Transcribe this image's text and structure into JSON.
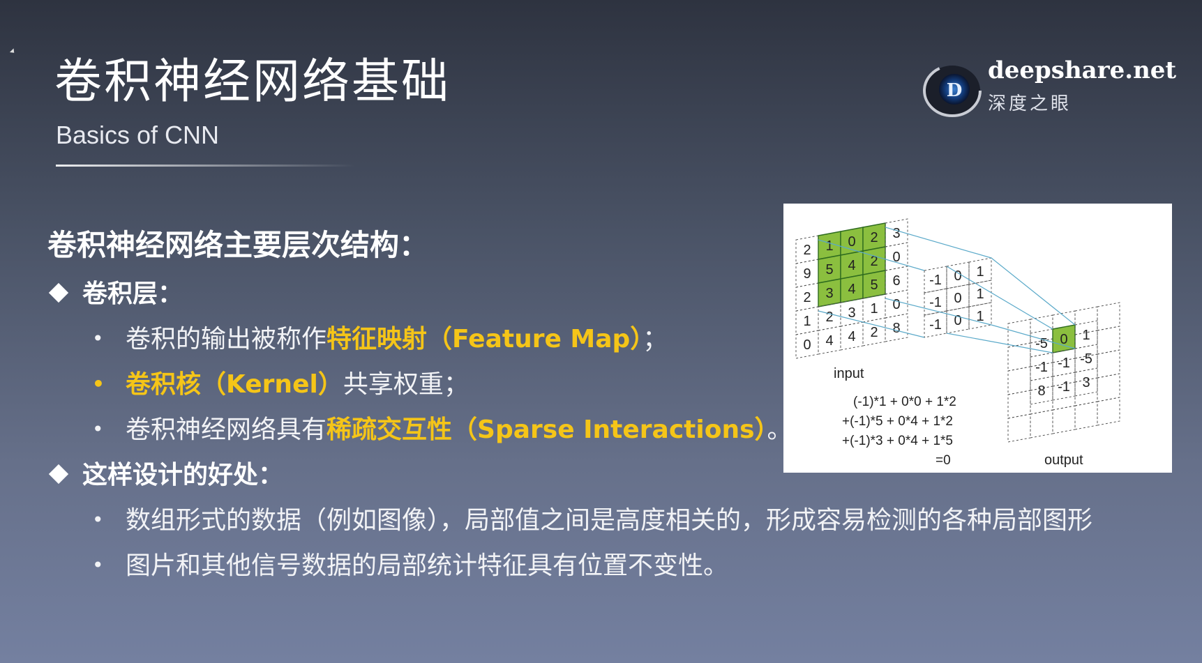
{
  "header": {
    "title": "卷积神经网络基础",
    "subtitle": "Basics of CNN"
  },
  "brand": {
    "name": "deepshare.net",
    "sub": "深度之眼",
    "logo_letter": "D"
  },
  "content": {
    "heading": "卷积神经网络主要层次结构：",
    "sections": [
      {
        "label": "卷积层：",
        "bullets": [
          {
            "pre": "卷积的输出被称作",
            "hl": "特征映射（Feature Map）",
            "post": "；"
          },
          {
            "pre": "",
            "hl": "卷积核（Kernel）",
            "post": "共享权重；"
          },
          {
            "pre": "卷积神经网络具有",
            "hl": "稀疏交互性（Sparse Interactions）",
            "post": "。"
          }
        ]
      },
      {
        "label": "这样设计的好处：",
        "bullets": [
          {
            "pre": "数组形式的数据（例如图像），局部值之间是高度相关的，形成容易检测的各种局部图形",
            "hl": "",
            "post": ""
          },
          {
            "pre": "图片和其他信号数据的局部统计特征具有位置不变性。",
            "hl": "",
            "post": ""
          }
        ]
      }
    ]
  },
  "figure": {
    "input_label": "input",
    "output_label": "output",
    "input_grid": [
      [
        "2",
        "1",
        "0",
        "2",
        "3"
      ],
      [
        "9",
        "5",
        "4",
        "2",
        "0"
      ],
      [
        "2",
        "3",
        "4",
        "5",
        "6"
      ],
      [
        "1",
        "2",
        "3",
        "1",
        "0"
      ],
      [
        "0",
        "4",
        "4",
        "2",
        "8"
      ]
    ],
    "kernel_grid": [
      [
        "-1",
        "0",
        "1"
      ],
      [
        "-1",
        "0",
        "1"
      ],
      [
        "-1",
        "0",
        "1"
      ]
    ],
    "output_grid": [
      [
        "-5",
        "0",
        "1"
      ],
      [
        "-1",
        "-1",
        "-5"
      ],
      [
        "8",
        "-1",
        "3"
      ]
    ],
    "equation": [
      "(-1)*1 +  0*0 + 1*2",
      "+(-1)*5 +  0*4 + 1*2",
      "+(-1)*3 +  0*4 + 1*5",
      "=0"
    ],
    "highlight_color": "#8bbf3f",
    "line_color": "#5aa9c9"
  },
  "colors": {
    "highlight": "#f5c518"
  }
}
